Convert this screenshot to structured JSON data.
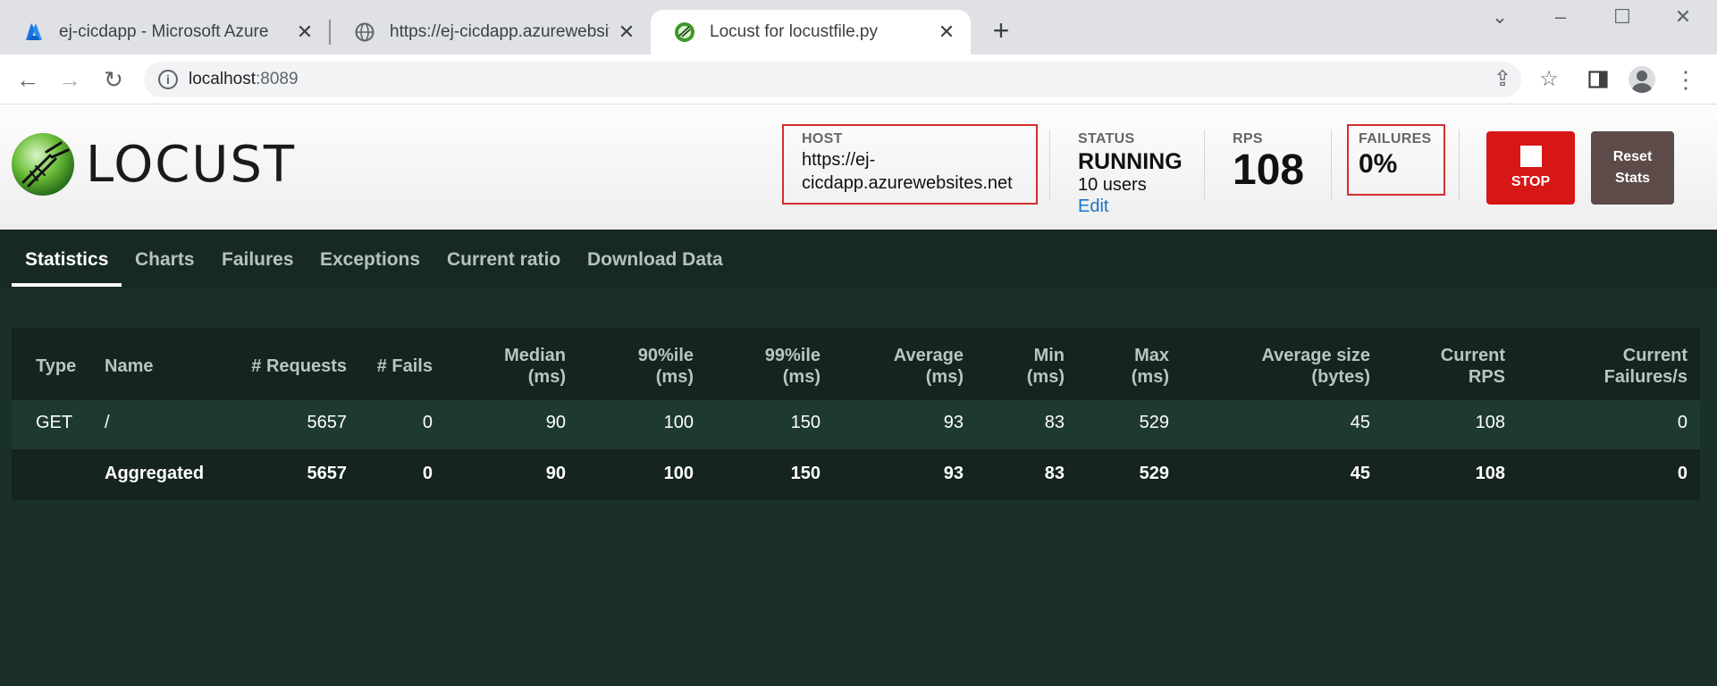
{
  "browser": {
    "tabs": [
      {
        "title": "ej-cicdapp - Microsoft Azure",
        "icon": "azure-logo-icon"
      },
      {
        "title": "https://ej-cicdapp.azurewebsites.net",
        "icon": "globe-icon"
      },
      {
        "title": "Locust for locustfile.py",
        "icon": "locust-favicon-icon"
      }
    ],
    "close_glyph": "✕",
    "new_tab_glyph": "+",
    "url_host": "localhost",
    "url_port": ":8089"
  },
  "header": {
    "logo_text": "LOCUST",
    "host_label": "HOST",
    "host_line1": "https://ej-",
    "host_line2": "cicdapp.azurewebsites.net",
    "status_label": "STATUS",
    "status_value": "RUNNING",
    "users": "10 users",
    "edit_label": "Edit",
    "rps_label": "RPS",
    "rps_value": "108",
    "failures_label": "FAILURES",
    "failures_value": "0%",
    "stop_label": "STOP",
    "reset_line1": "Reset",
    "reset_line2": "Stats",
    "stop_color": "#d71616",
    "highlight_color": "#d32f2f"
  },
  "nav": [
    "Statistics",
    "Charts",
    "Failures",
    "Exceptions",
    "Current ratio",
    "Download Data"
  ],
  "table": {
    "headers": [
      [
        "Type",
        ""
      ],
      [
        "Name",
        ""
      ],
      [
        "# Requests",
        ""
      ],
      [
        "# Fails",
        ""
      ],
      [
        "Median",
        "(ms)"
      ],
      [
        "90%ile",
        "(ms)"
      ],
      [
        "99%ile",
        "(ms)"
      ],
      [
        "Average",
        "(ms)"
      ],
      [
        "Min",
        "(ms)"
      ],
      [
        "Max",
        "(ms)"
      ],
      [
        "Average size",
        "(bytes)"
      ],
      [
        "Current",
        "RPS"
      ],
      [
        "Current",
        "Failures/s"
      ]
    ],
    "rows": [
      [
        "GET",
        "/",
        "5657",
        "0",
        "90",
        "100",
        "150",
        "93",
        "83",
        "529",
        "45",
        "108",
        "0"
      ],
      [
        "",
        "Aggregated",
        "5657",
        "0",
        "90",
        "100",
        "150",
        "93",
        "83",
        "529",
        "45",
        "108",
        "0"
      ]
    ]
  }
}
